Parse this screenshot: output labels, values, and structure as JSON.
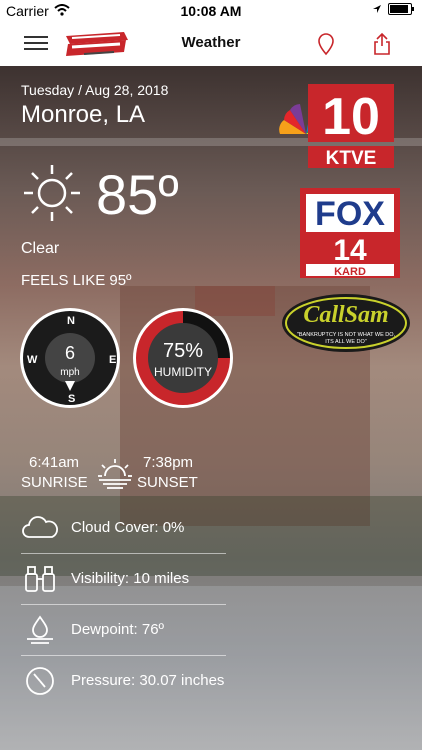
{
  "status": {
    "carrier": "Carrier",
    "time": "10:08 AM"
  },
  "nav": {
    "title": "Weather"
  },
  "weather": {
    "date": "Tuesday / Aug 28, 2018",
    "city": "Monroe, LA",
    "temperature": "85º",
    "condition": "Clear",
    "feels_like": "FEELS LIKE 95º",
    "wind": {
      "speed": "6",
      "unit": "mph",
      "n": "N",
      "s": "S",
      "e": "E",
      "w": "W"
    },
    "humidity": {
      "value": "75%",
      "label": "HUMIDITY",
      "fraction": 0.75
    },
    "sunrise": {
      "time": "6:41am",
      "label": "SUNRISE"
    },
    "sunset": {
      "time": "7:38pm",
      "label": "SUNSET"
    },
    "details": {
      "cloud_cover": "Cloud Cover: 0%",
      "visibility": "Visibility: 10 miles",
      "dewpoint": "Dewpoint: 76º",
      "pressure": "Pressure: 30.07 inches"
    }
  },
  "brands": {
    "ktve": {
      "number": "10",
      "label": "KTVE"
    },
    "kard": {
      "name": "FOX",
      "number": "14",
      "label": "KARD"
    },
    "callsam": {
      "name": "CallSam",
      "tagline1": "\"BANKRUPTCY IS NOT WHAT WE DO,",
      "tagline2": "ITS ALL WE DO\""
    }
  },
  "colors": {
    "humidity_ring": "#c8262b",
    "brand_red": "#c8262b"
  }
}
